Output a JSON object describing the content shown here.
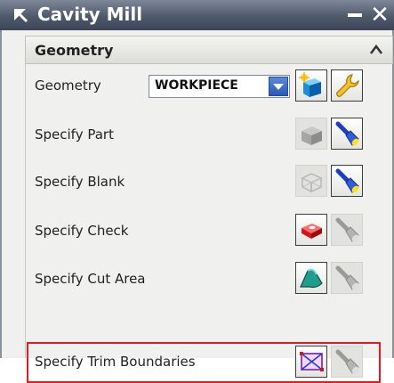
{
  "window": {
    "title": "Cavity Mill"
  },
  "section": {
    "title": "Geometry"
  },
  "rows": {
    "geometry": {
      "label": "Geometry",
      "value": "WORKPIECE"
    },
    "part": {
      "label": "Specify Part"
    },
    "blank": {
      "label": "Specify Blank"
    },
    "check": {
      "label": "Specify Check"
    },
    "cut_area": {
      "label": "Specify Cut Area"
    },
    "trim": {
      "label": "Specify Trim Boundaries"
    }
  },
  "colors": {
    "titlebar": "#4f596c",
    "highlight": "#e01b22",
    "flashlight_active": "#1a3fc4"
  }
}
